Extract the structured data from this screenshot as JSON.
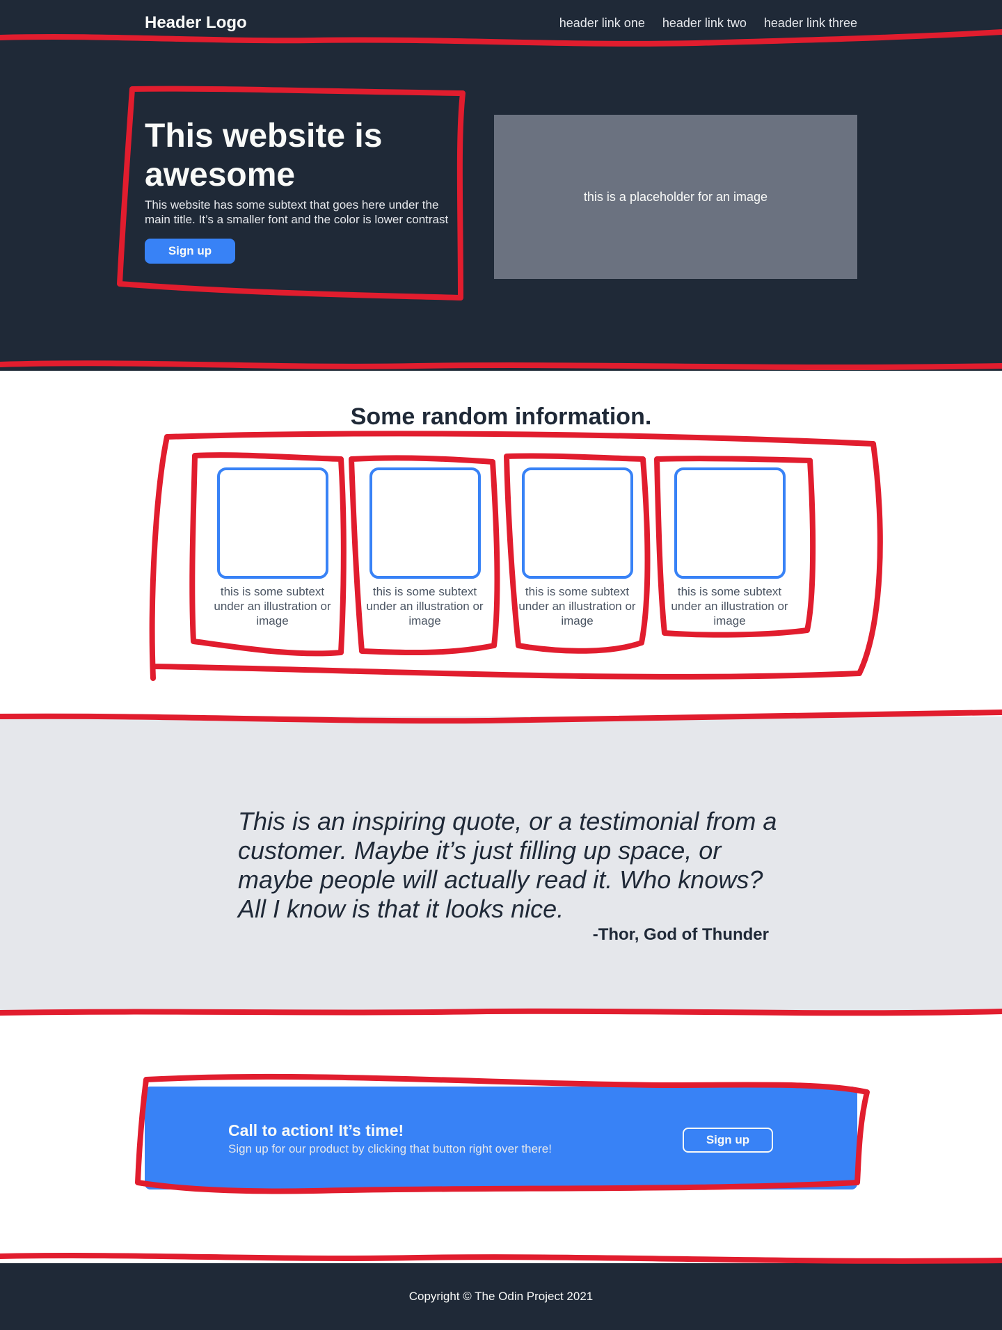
{
  "header": {
    "logo": "Header Logo",
    "links": [
      "header link one",
      "header link two",
      "header link three"
    ]
  },
  "hero": {
    "title": "This website is awesome",
    "subtext": "This website has some subtext that goes here under the main title.  It’s a smaller font and the color is lower contrast",
    "button": "Sign up",
    "image_placeholder": "this is a placeholder for an image"
  },
  "info": {
    "title": "Some random information.",
    "cards": [
      {
        "text": "this is some subtext under an illustration or image"
      },
      {
        "text": "this is some subtext under an illustration or image"
      },
      {
        "text": "this is some subtext under an illustration or image"
      },
      {
        "text": "this is some subtext under an illustration or image"
      }
    ]
  },
  "quote": {
    "text": "This is an inspiring quote, or a testimonial from a customer.  Maybe it’s just filling up space, or maybe people will actually read it. Who knows?  All I know is that it looks nice.",
    "author": "-Thor, God of Thunder"
  },
  "cta": {
    "title": "Call to action! It’s time!",
    "subtext": "Sign up for our product by clicking that button right over there!",
    "button": "Sign up"
  },
  "footer": {
    "text": "Copyright  ©  The Odin Project 2021"
  },
  "colors": {
    "dark": "#1f2937",
    "accent_blue": "#3882f6",
    "light_gray": "#e5e7eb",
    "placeholder_gray": "#6b7280",
    "annotation_red": "#e11d2e"
  }
}
